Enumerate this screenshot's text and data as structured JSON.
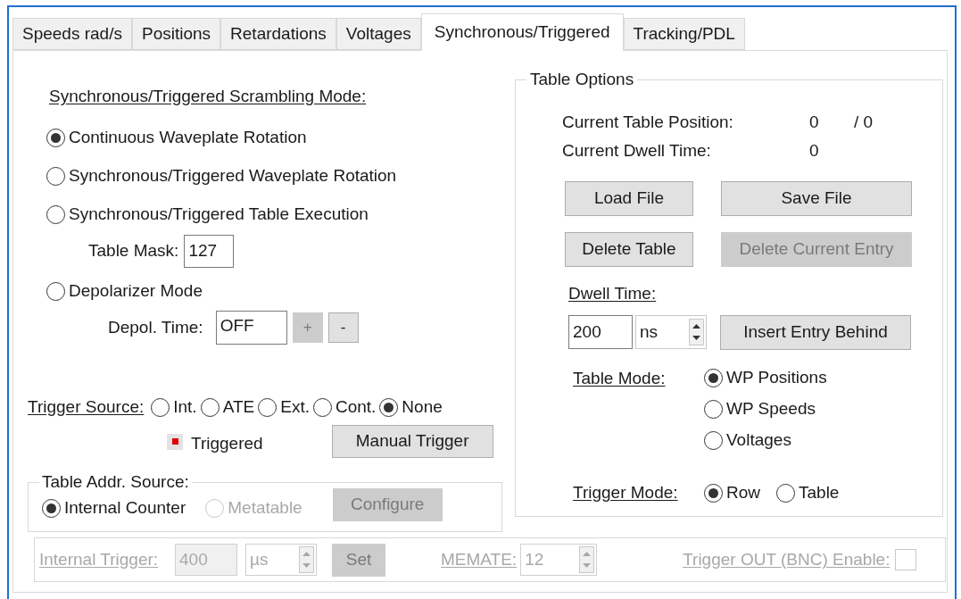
{
  "tabs": [
    {
      "label": "Speeds rad/s",
      "selected": false
    },
    {
      "label": "Positions",
      "selected": false
    },
    {
      "label": "Retardations",
      "selected": false
    },
    {
      "label": "Voltages",
      "selected": false
    },
    {
      "label": "Synchronous/Triggered",
      "selected": true
    },
    {
      "label": "Tracking/PDL",
      "selected": false
    }
  ],
  "scrambling_mode": {
    "label": "Synchronous/Triggered Scrambling Mode:",
    "options": [
      {
        "label": "Continuous Waveplate Rotation",
        "selected": true
      },
      {
        "label": "Synchronous/Triggered Waveplate Rotation",
        "selected": false
      },
      {
        "label": "Synchronous/Triggered Table Execution",
        "selected": false
      },
      {
        "label": "Depolarizer Mode",
        "selected": false
      }
    ]
  },
  "table_mask": {
    "label": "Table Mask:",
    "value": "127"
  },
  "depol_time": {
    "label": "Depol. Time:",
    "value": "OFF",
    "buttons": [
      {
        "label": "+",
        "disabled": true
      },
      {
        "label": "-",
        "disabled": false
      }
    ]
  },
  "trigger_source": {
    "label": "Trigger Source:",
    "options": [
      {
        "label": "Int.",
        "selected": false
      },
      {
        "label": "ATE",
        "selected": false
      },
      {
        "label": "Ext.",
        "selected": false
      },
      {
        "label": "Cont.",
        "selected": false
      },
      {
        "label": "None",
        "selected": true
      }
    ]
  },
  "triggered": {
    "label": "Triggered",
    "on": true
  },
  "manual_trigger": {
    "label": "Manual Trigger",
    "disabled": false
  },
  "table_addr_source": {
    "title": "Table Addr. Source:",
    "options": [
      {
        "label": "Internal Counter",
        "selected": true,
        "disabled": false
      },
      {
        "label": "Metatable",
        "selected": false,
        "disabled": true
      }
    ],
    "configure": {
      "label": "Configure",
      "disabled": true
    }
  },
  "table_options": {
    "title": "Table Options",
    "position_label": "Current Table Position:",
    "position_value": "0",
    "position_total": "/ 0",
    "dwell_label": "Current Dwell Time:",
    "dwell_value": "0",
    "buttons": [
      {
        "label": "Load File",
        "disabled": false
      },
      {
        "label": "Save File",
        "disabled": false
      },
      {
        "label": "Delete Table",
        "disabled": false
      },
      {
        "label": "Delete Current Entry",
        "disabled": true
      }
    ],
    "dwell_time": {
      "label": "Dwell Time:",
      "value": "200",
      "unit": "ns"
    },
    "insert": {
      "label": "Insert Entry Behind",
      "disabled": false
    },
    "table_mode": {
      "label": "Table Mode:",
      "options": [
        {
          "label": "WP Positions",
          "selected": true
        },
        {
          "label": "WP Speeds",
          "selected": false
        },
        {
          "label": "Voltages",
          "selected": false
        }
      ]
    },
    "trigger_mode": {
      "label": "Trigger Mode:",
      "options": [
        {
          "label": "Row",
          "selected": true
        },
        {
          "label": "Table",
          "selected": false
        }
      ]
    }
  },
  "internal_trigger_bar": {
    "disabled": true,
    "internal_trigger": {
      "label": "Internal Trigger:",
      "value": "400",
      "unit": "µs"
    },
    "set": {
      "label": "Set"
    },
    "memate": {
      "label": "MEMATE:",
      "value": "12"
    },
    "trigger_out": {
      "label": "Trigger OUT (BNC) Enable:",
      "checked": false
    }
  }
}
